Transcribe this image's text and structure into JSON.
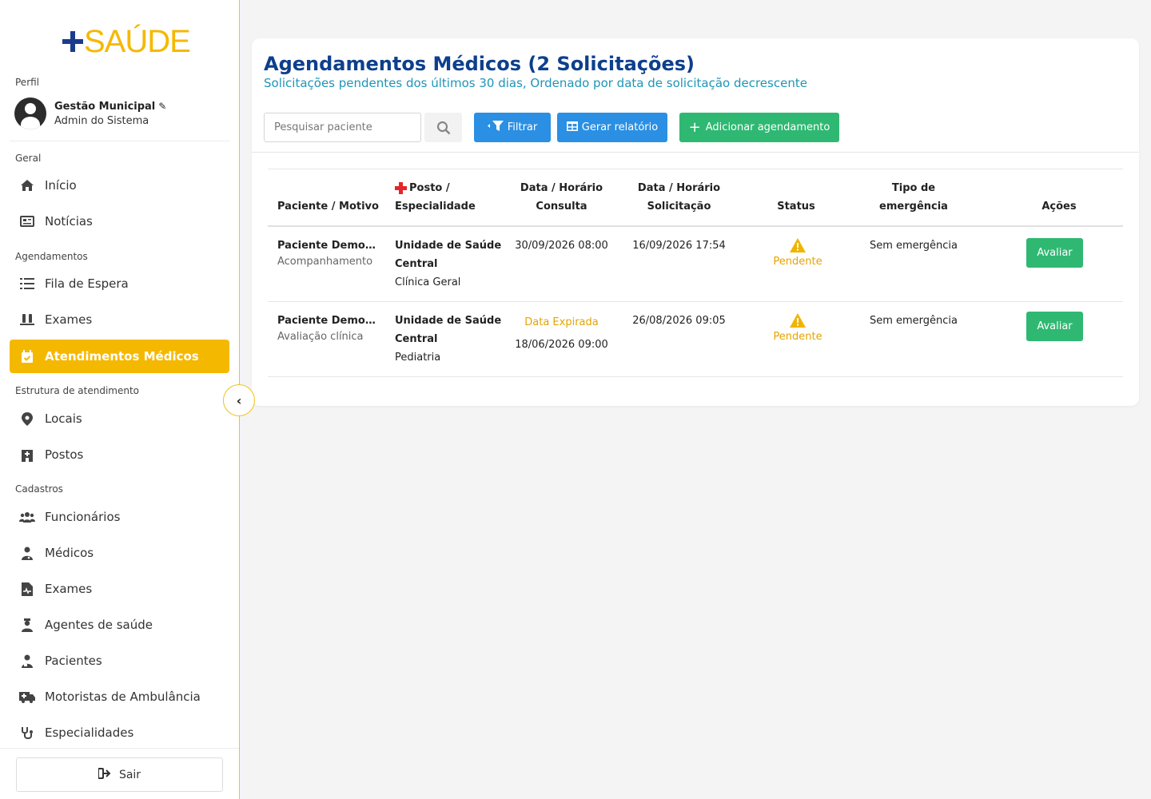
{
  "brand": {
    "logo_text": "SAÚDE"
  },
  "sidebar": {
    "profile_label": "Perfil",
    "profile": {
      "name": "Gestão Municipal",
      "role": "Admin do Sistema"
    },
    "sections": {
      "geral": "Geral",
      "agendamentos": "Agendamentos",
      "estrutura": "Estrutura de atendimento",
      "cadastros": "Cadastros"
    },
    "items": {
      "inicio": "Início",
      "noticias": "Notícias",
      "fila": "Fila de Espera",
      "exames": "Exames",
      "atendimentos": "Atendimentos Médicos",
      "locais": "Locais",
      "postos": "Postos",
      "funcionarios": "Funcionários",
      "medicos": "Médicos",
      "exames_cad": "Exames",
      "agentes": "Agentes de saúde",
      "pacientes": "Pacientes",
      "motoristas": "Motoristas de Ambulância",
      "especialidades": "Especialidades"
    },
    "logout_label": "Sair"
  },
  "main": {
    "title": "Agendamentos Médicos (2 Solicitações)",
    "subtitle": "Solicitações pendentes dos últimos 30 dias, Ordenado por data de solicitação decrescente",
    "search": {
      "placeholder": "Pesquisar paciente",
      "value": ""
    },
    "buttons": {
      "filter": "Filtrar",
      "report": "Gerar relatório",
      "add": "Adicionar agendamento"
    },
    "table": {
      "headers": {
        "paciente": "Paciente / Motivo",
        "posto_1": "Posto /",
        "posto_2": "Especialidade",
        "consulta_1": "Data / Horário",
        "consulta_2": "Consulta",
        "solicitacao_1": "Data / Horário",
        "solicitacao_2": "Solicitação",
        "status": "Status",
        "tipo_1": "Tipo de",
        "tipo_2": "emergência",
        "acoes": "Ações"
      },
      "rows": [
        {
          "paciente": "Paciente Demonstração",
          "motivo": "Acompanhamento",
          "posto_1": "Unidade de Saúde",
          "posto_2": "Central",
          "especialidade": "Clínica Geral",
          "consulta": "30/09/2026 08:00",
          "solicitacao": "16/09/2026 17:54",
          "status": "Pendente",
          "tipo": "Sem emergência",
          "acao": "Avaliar"
        },
        {
          "paciente": "Paciente Demonstração",
          "motivo": "Avaliação clínica",
          "posto_1": "Unidade de Saúde",
          "posto_2": "Central",
          "especialidade": "Pediatria",
          "consulta_flag": "Data Expirada",
          "consulta": "18/06/2026 09:00",
          "solicitacao": "26/08/2026 09:05",
          "status": "Pendente",
          "tipo": "Sem emergência",
          "acao": "Avaliar"
        }
      ]
    }
  },
  "colors": {
    "accent": "#f5b800",
    "primary": "#2b8fe3",
    "success": "#2fb872",
    "title": "#0d3f8c",
    "warning": "#e6a300"
  }
}
